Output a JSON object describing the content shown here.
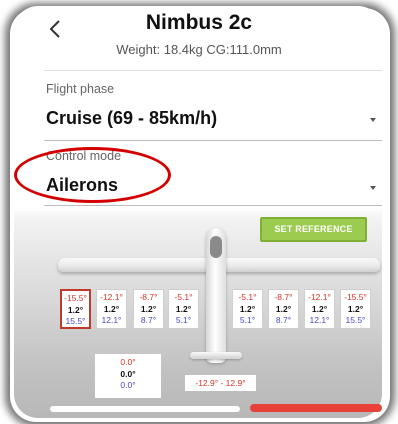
{
  "header": {
    "back_icon": "chevron-left-icon",
    "title": "Nimbus 2c",
    "subtitle": "Weight: 18.4kg  CG:111.0mm"
  },
  "flight_phase": {
    "label": "Flight phase",
    "value": "Cruise (69 - 85km/h)"
  },
  "control_mode": {
    "label": "Control mode",
    "value": "Ailerons"
  },
  "set_reference_label": "SET REFERENCE",
  "wing_surfaces": [
    {
      "top": "-15.5°",
      "mid": "1.2°",
      "bottom": "15.5°",
      "selected": true
    },
    {
      "top": "-12.1°",
      "mid": "1.2°",
      "bottom": "12.1°",
      "selected": false
    },
    {
      "top": "-8.7°",
      "mid": "1.2°",
      "bottom": "8.7°",
      "selected": false
    },
    {
      "top": "-5.1°",
      "mid": "1.2°",
      "bottom": "5.1°",
      "selected": false
    },
    {
      "top": "-5.1°",
      "mid": "1.2°",
      "bottom": "5.1°",
      "selected": false
    },
    {
      "top": "-8.7°",
      "mid": "1.2°",
      "bottom": "8.7°",
      "selected": false
    },
    {
      "top": "-12.1°",
      "mid": "1.2°",
      "bottom": "12.1°",
      "selected": false
    },
    {
      "top": "-15.5°",
      "mid": "1.2°",
      "bottom": "15.5°",
      "selected": false
    }
  ],
  "tail": {
    "top": "0.0°",
    "mid": "0.0°",
    "bottom": "0.0°"
  },
  "rudder_range": "-12.9° - 12.9°",
  "colors": {
    "accent_button": "#9ccc4f",
    "negative_value": "#d0352b",
    "positive_value": "#4a48c8",
    "annotation_circle": "#d40000",
    "bottom_bar": "#e8413a"
  }
}
